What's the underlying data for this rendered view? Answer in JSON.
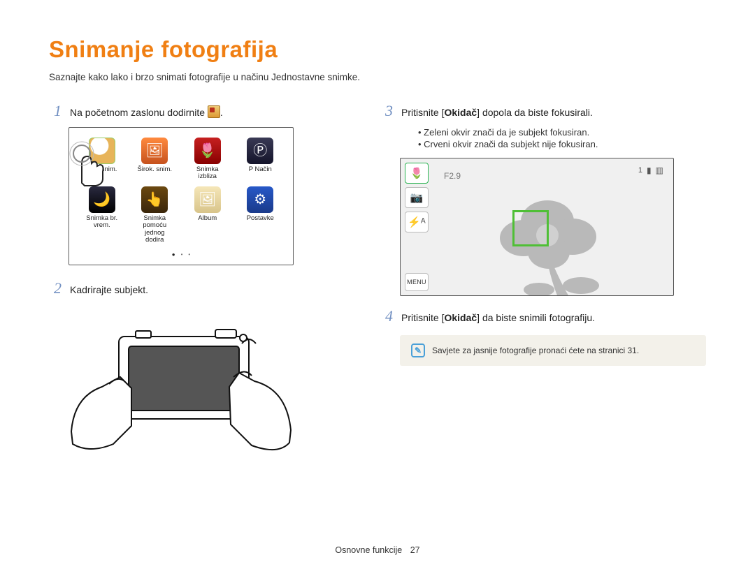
{
  "title": "Snimanje fotografija",
  "subtitle": "Saznajte kako lako i brzo snimati fotografije u načinu Jednostavne snimke.",
  "steps": {
    "s1": {
      "num": "1",
      "pre": "Na početnom zaslonu dodirnite ",
      "post": "."
    },
    "s2": {
      "num": "2",
      "text": "Kadrirajte subjekt."
    },
    "s3": {
      "num": "3",
      "pre": "Pritisnite [",
      "kw": "Okidač",
      "post": "] dopola da biste fokusirali.",
      "sub1": "Zeleni okvir znači da je subjekt fokusiran.",
      "sub2": "Crveni okvir znači da subjekt nije fokusiran."
    },
    "s4": {
      "num": "4",
      "pre": "Pritisnite [",
      "kw": "Okidač",
      "post": "] da biste snimili fotografiju."
    }
  },
  "apps": [
    {
      "label": "Jed. snim.",
      "key": "easy"
    },
    {
      "label": "Širok. snim.",
      "key": "wide"
    },
    {
      "label": "Snimka izbliza",
      "key": "close"
    },
    {
      "label": "P Način",
      "key": "p"
    },
    {
      "label": "Snimka br. vrem.",
      "key": "night"
    },
    {
      "label": "Snimka pomoću jednog dodira",
      "key": "onetouch"
    },
    {
      "label": "Album",
      "key": "album"
    },
    {
      "label": "Postavke",
      "key": "settings"
    }
  ],
  "appGlyphs": {
    "easy": "",
    "wide": "🖼",
    "close": "🌷",
    "p": "Ⓟ",
    "night": "🌙",
    "onetouch": "👆",
    "album": "🖼",
    "settings": "⚙"
  },
  "viewfinder": {
    "fnum": "F2.9",
    "count": "1",
    "buttons": {
      "macro": "🌷",
      "photo": "📷",
      "flash": "⚡ᴬ",
      "menu": "MENU"
    }
  },
  "tip": "Savjete za jasnije fotografije pronaći ćete na stranici 31.",
  "footer": {
    "section": "Osnovne funkcije",
    "page": "27"
  }
}
